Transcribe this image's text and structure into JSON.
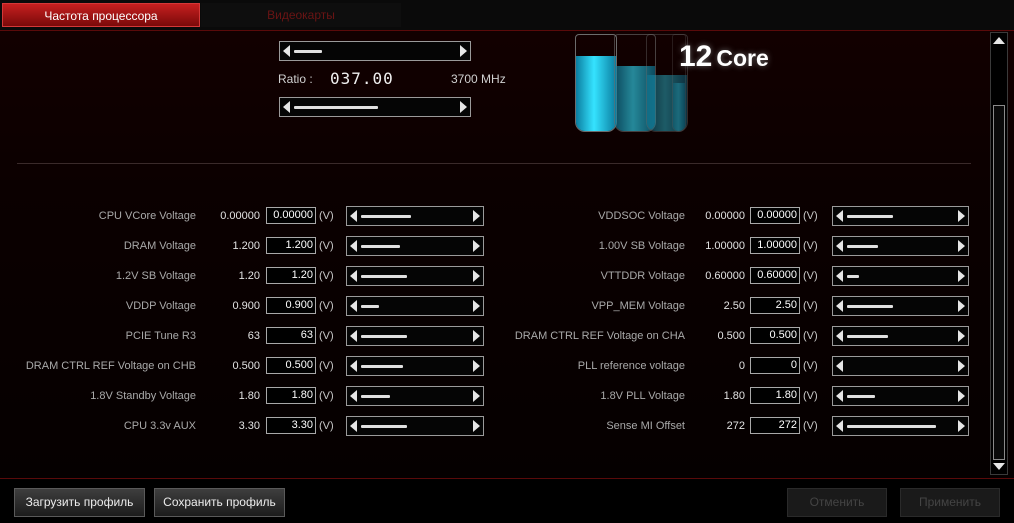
{
  "tabs": [
    {
      "label": "Частота процессора"
    },
    {
      "label": "Видеокарты"
    }
  ],
  "ratio": {
    "label": "Ratio :",
    "value": "037.00",
    "frequency": "3700 MHz"
  },
  "core": {
    "count": "12",
    "word": "Core"
  },
  "unit": "(V)",
  "left_params": [
    {
      "label": "CPU VCore Voltage",
      "current": "0.00000",
      "input": "0.00000",
      "level": 0.45
    },
    {
      "label": "DRAM Voltage",
      "current": "1.200",
      "input": "1.200",
      "level": 0.35
    },
    {
      "label": "1.2V SB Voltage",
      "current": "1.20",
      "input": "1.20",
      "level": 0.42
    },
    {
      "label": "VDDP Voltage",
      "current": "0.900",
      "input": "0.900",
      "level": 0.16
    },
    {
      "label": "PCIE Tune R3",
      "current": "63",
      "input": "63",
      "level": 0.42
    },
    {
      "label": "DRAM CTRL REF Voltage on CHB",
      "current": "0.500",
      "input": "0.500",
      "level": 0.38
    },
    {
      "label": "1.8V Standby Voltage",
      "current": "1.80",
      "input": "1.80",
      "level": 0.26
    },
    {
      "label": "CPU 3.3v AUX",
      "current": "3.30",
      "input": "3.30",
      "level": 0.42
    }
  ],
  "right_params": [
    {
      "label": "VDDSOC Voltage",
      "current": "0.00000",
      "input": "0.00000",
      "level": 0.42
    },
    {
      "label": "1.00V SB Voltage",
      "current": "1.00000",
      "input": "1.00000",
      "level": 0.28
    },
    {
      "label": "VTTDDR Voltage",
      "current": "0.60000",
      "input": "0.60000",
      "level": 0.11
    },
    {
      "label": "VPP_MEM Voltage",
      "current": "2.50",
      "input": "2.50",
      "level": 0.42
    },
    {
      "label": "DRAM CTRL REF Voltage on CHA",
      "current": "0.500",
      "input": "0.500",
      "level": 0.38
    },
    {
      "label": "PLL reference voltage",
      "current": "0",
      "input": "0",
      "level": 0.0
    },
    {
      "label": "1.8V PLL Voltage",
      "current": "1.80",
      "input": "1.80",
      "level": 0.26
    },
    {
      "label": "Sense MI Offset",
      "current": "272",
      "input": "272",
      "level": 0.82
    }
  ],
  "buttons": {
    "load": "Загрузить профиль",
    "save": "Сохранить профиль",
    "cancel": "Отменить",
    "apply": "Применить"
  },
  "colors": {
    "accent": "#c62020",
    "liquid": "#35e3ff"
  }
}
